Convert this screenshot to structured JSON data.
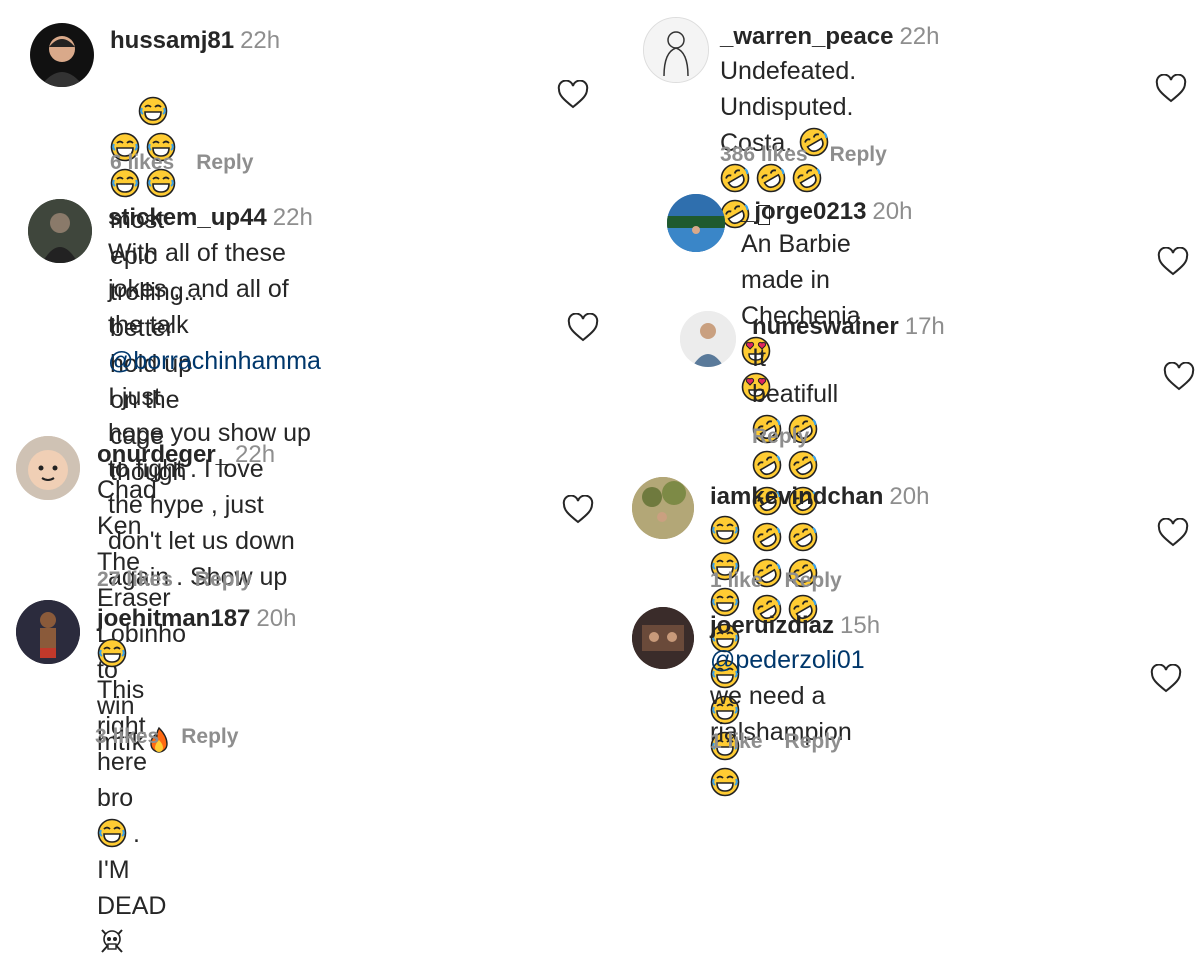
{
  "comments": [
    {
      "username": "hussamj81",
      "time": "22h",
      "text_suffix": " most epic trolling...",
      "line2": "better hold up on the cage though",
      "likes": "6 likes",
      "reply": "Reply"
    },
    {
      "username": "stickem_up44",
      "time": "22h",
      "lines": [
        "With all of these jokes , and all of",
        "the talk ",
        "@borrachinhamma",
        " I just",
        "hope you show up to fight . I love",
        "the hype , just don't let us down",
        "again . Show up"
      ]
    },
    {
      "username": "onurdeger_",
      "time": "22h",
      "line1": "Chad Ken The Eraser Lobinho to",
      "line2": "win mtfk",
      "likes": "27 likes",
      "reply": "Reply"
    },
    {
      "username": "joehitman187",
      "time": "20h",
      "line1a": " This right here bro",
      "line1b": ". I'M",
      "line2": "DEAD",
      "likes": "3 likes",
      "reply": "Reply"
    },
    {
      "username": "_warren_peace",
      "time": "22h",
      "line1": "Undefeated. Undisputed. Costa. ",
      "likes": "386 likes",
      "reply": "Reply"
    },
    {
      "username": "_jorge0213",
      "time": "20h",
      "line1": "An Barbie made in Chechenia "
    },
    {
      "username": "nuneswainer",
      "time": "17h",
      "line1": "It beatifull ",
      "reply": "Reply"
    },
    {
      "username": "iamkevindchan",
      "time": "20h",
      "likes": "1 like",
      "reply": "Reply"
    },
    {
      "username": "joeruizdiaz",
      "time": "15h",
      "mention": "@pederzoli01",
      "line1": " we need a",
      "line2": "rialshampion",
      "likes": "1 like",
      "reply": "Reply"
    }
  ],
  "emoji_names": [
    "joy-emoji",
    "rofl-emoji",
    "heart-eyes-emoji",
    "fire-emoji",
    "skull-crossbones-emoji"
  ]
}
